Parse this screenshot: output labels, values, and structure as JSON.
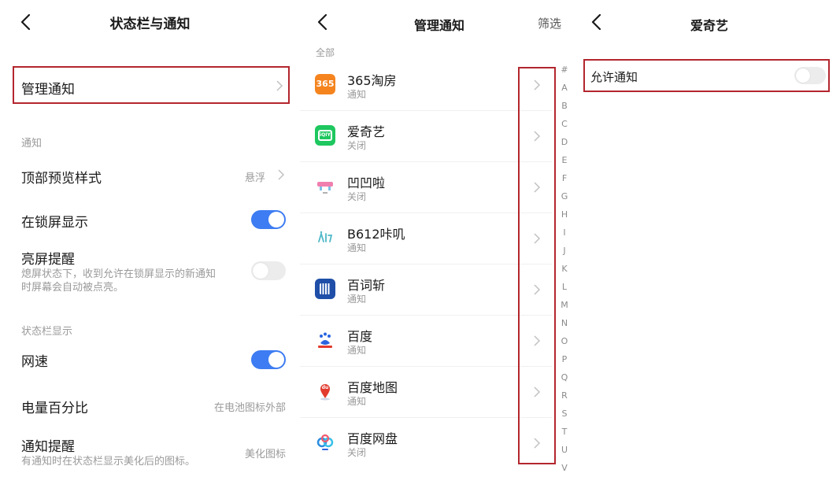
{
  "colors": {
    "accent": "#3d7cf2",
    "highlight": "#b3262e"
  },
  "status_notify": {
    "title": "状态栏与通知",
    "manage": "管理通知",
    "section_notify": "通知",
    "top_preview": {
      "label": "顶部预览样式",
      "value": "悬浮"
    },
    "lockscreen": {
      "label": "在锁屏显示",
      "on": true
    },
    "wake": {
      "label": "亮屏提醒",
      "desc1": "熄屏状态下，收到允许在锁屏显示的新通知",
      "desc2": "时屏幕会自动被点亮。",
      "on": false
    },
    "section_statusbar": "状态栏显示",
    "netspeed": {
      "label": "网速",
      "on": true
    },
    "battery": {
      "label": "电量百分比",
      "value": "在电池图标外部"
    },
    "notify_reminder": {
      "label": "通知提醒",
      "desc": "有通知时在状态栏显示美化后的图标。",
      "value": "美化图标"
    }
  },
  "manage_notify": {
    "title": "管理通知",
    "filter": "筛选",
    "section_all": "全部",
    "apps": [
      {
        "name": "365淘房",
        "status": "通知",
        "icon": "app-365-icon"
      },
      {
        "name": "爱奇艺",
        "status": "关闭",
        "icon": "app-iqiyi-icon"
      },
      {
        "name": "凹凹啦",
        "status": "关闭",
        "icon": "app-aoaola-icon"
      },
      {
        "name": "B612咔叽",
        "status": "通知",
        "icon": "app-b612-icon"
      },
      {
        "name": "百词斩",
        "status": "通知",
        "icon": "app-baicizhan-icon"
      },
      {
        "name": "百度",
        "status": "通知",
        "icon": "app-baidu-icon"
      },
      {
        "name": "百度地图",
        "status": "通知",
        "icon": "app-baidu-map-icon"
      },
      {
        "name": "百度网盘",
        "status": "关闭",
        "icon": "app-baidu-netdisk-icon"
      }
    ],
    "index": [
      "#",
      "A",
      "B",
      "C",
      "D",
      "E",
      "F",
      "G",
      "H",
      "I",
      "J",
      "K",
      "L",
      "M",
      "N",
      "O",
      "P",
      "Q",
      "R",
      "S",
      "T",
      "U",
      "V"
    ]
  },
  "iqiyi": {
    "title": "爱奇艺",
    "allow": {
      "label": "允许通知",
      "on": false
    }
  },
  "icon_text": {
    "app_365": "365",
    "app_iqiyi": "iQIY",
    "app_baidu_map": "du"
  }
}
